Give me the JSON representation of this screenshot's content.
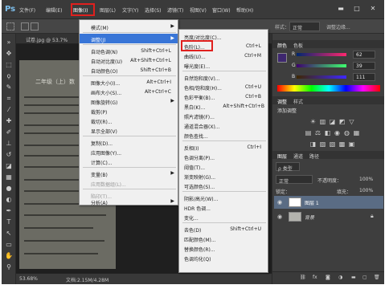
{
  "app": {
    "logo": "Ps"
  },
  "menubar": {
    "items": [
      {
        "label": "文件(F)"
      },
      {
        "label": "编辑(E)"
      },
      {
        "label": "图像(I)",
        "active": true
      },
      {
        "label": "图层(L)"
      },
      {
        "label": "文字(Y)"
      },
      {
        "label": "选择(S)"
      },
      {
        "label": "滤镜(T)"
      },
      {
        "label": "视图(V)"
      },
      {
        "label": "窗口(W)"
      },
      {
        "label": "帮助(H)"
      }
    ],
    "window_controls": {
      "minimize": "▬",
      "maximize": "□",
      "close": "✕"
    }
  },
  "optionsbar": {
    "style_label": "样式：",
    "style_value": "正常",
    "width_label": "宽度：",
    "height_label": "高度：",
    "refine_edge": "调整边缘..."
  },
  "document": {
    "tab_title": "试卷.jpg @ 53.7%",
    "paper_heading": "二年级（上）数",
    "status_zoom": "53.68%",
    "status_doc": "文档:2.15M/4.28M"
  },
  "image_menu": {
    "items": [
      {
        "label": "模式(M)",
        "submenu": true
      },
      {
        "label": "调整(J)",
        "submenu": true,
        "highlighted": true
      },
      {
        "label": "自动色调(N)",
        "shortcut": "Shift+Ctrl+L"
      },
      {
        "label": "自动对比度(U)",
        "shortcut": "Alt+Shift+Ctrl+L"
      },
      {
        "label": "自动颜色(O)",
        "shortcut": "Shift+Ctrl+B"
      },
      {
        "label": "图像大小(I)...",
        "shortcut": "Alt+Ctrl+I"
      },
      {
        "label": "画布大小(S)...",
        "shortcut": "Alt+Ctrl+C"
      },
      {
        "label": "图像旋转(G)",
        "submenu": true
      },
      {
        "label": "裁剪(P)"
      },
      {
        "label": "裁切(R)..."
      },
      {
        "label": "显示全部(V)"
      },
      {
        "label": "复制(D)..."
      },
      {
        "label": "应用图像(Y)..."
      },
      {
        "label": "计算(C)..."
      },
      {
        "label": "变量(B)",
        "submenu": true
      },
      {
        "label": "应用数据组(L)...",
        "disabled": true
      },
      {
        "label": "陷印(T)...",
        "disabled": true
      },
      {
        "label": "分析(A)",
        "submenu": true
      }
    ]
  },
  "adjust_menu": {
    "items": [
      {
        "label": "亮度/对比度(C)..."
      },
      {
        "label": "色阶(L)...",
        "shortcut": "Ctrl+L",
        "boxed": true
      },
      {
        "label": "曲线(U)...",
        "shortcut": "Ctrl+M"
      },
      {
        "label": "曝光度(E)..."
      },
      {
        "label": "自然饱和度(V)..."
      },
      {
        "label": "色相/饱和度(H)...",
        "shortcut": "Ctrl+U"
      },
      {
        "label": "色彩平衡(B)...",
        "shortcut": "Ctrl+B"
      },
      {
        "label": "黑白(K)...",
        "shortcut": "Alt+Shift+Ctrl+B"
      },
      {
        "label": "照片滤镜(F)..."
      },
      {
        "label": "通道混合器(X)..."
      },
      {
        "label": "颜色查找..."
      },
      {
        "label": "反相(I)",
        "shortcut": "Ctrl+I"
      },
      {
        "label": "色调分离(P)..."
      },
      {
        "label": "阈值(T)..."
      },
      {
        "label": "渐变映射(G)..."
      },
      {
        "label": "可选颜色(S)..."
      },
      {
        "label": "阴影/高光(W)..."
      },
      {
        "label": "HDR 色调..."
      },
      {
        "label": "变化..."
      },
      {
        "label": "去色(D)",
        "shortcut": "Shift+Ctrl+U"
      },
      {
        "label": "匹配颜色(M)..."
      },
      {
        "label": "替换颜色(R)..."
      },
      {
        "label": "色调均化(Q)"
      }
    ]
  },
  "color_panel": {
    "tabs": [
      "颜色",
      "色板"
    ],
    "channels": [
      {
        "label": "R",
        "value": "62"
      },
      {
        "label": "G",
        "value": "39"
      },
      {
        "label": "B",
        "value": "111"
      }
    ],
    "foreground_color": "#3e276f",
    "background_color": "#ffffff"
  },
  "adjustments_panel": {
    "tabs": [
      "调整",
      "样式"
    ],
    "hint": "添加调整"
  },
  "layers_panel": {
    "tabs": [
      "图层",
      "通道",
      "路径"
    ],
    "kind_label": "ρ 类型",
    "blend_mode": "正常",
    "opacity_label": "不透明度：",
    "opacity_value": "100%",
    "lock_label": "锁定：",
    "fill_label": "填充：",
    "fill_value": "100%",
    "layers": [
      {
        "name": "图层 1",
        "selected": true
      },
      {
        "name": "背景",
        "locked": true
      }
    ]
  },
  "colors": {
    "accent": "#3875d7",
    "highlight_box": "#e0201e"
  }
}
